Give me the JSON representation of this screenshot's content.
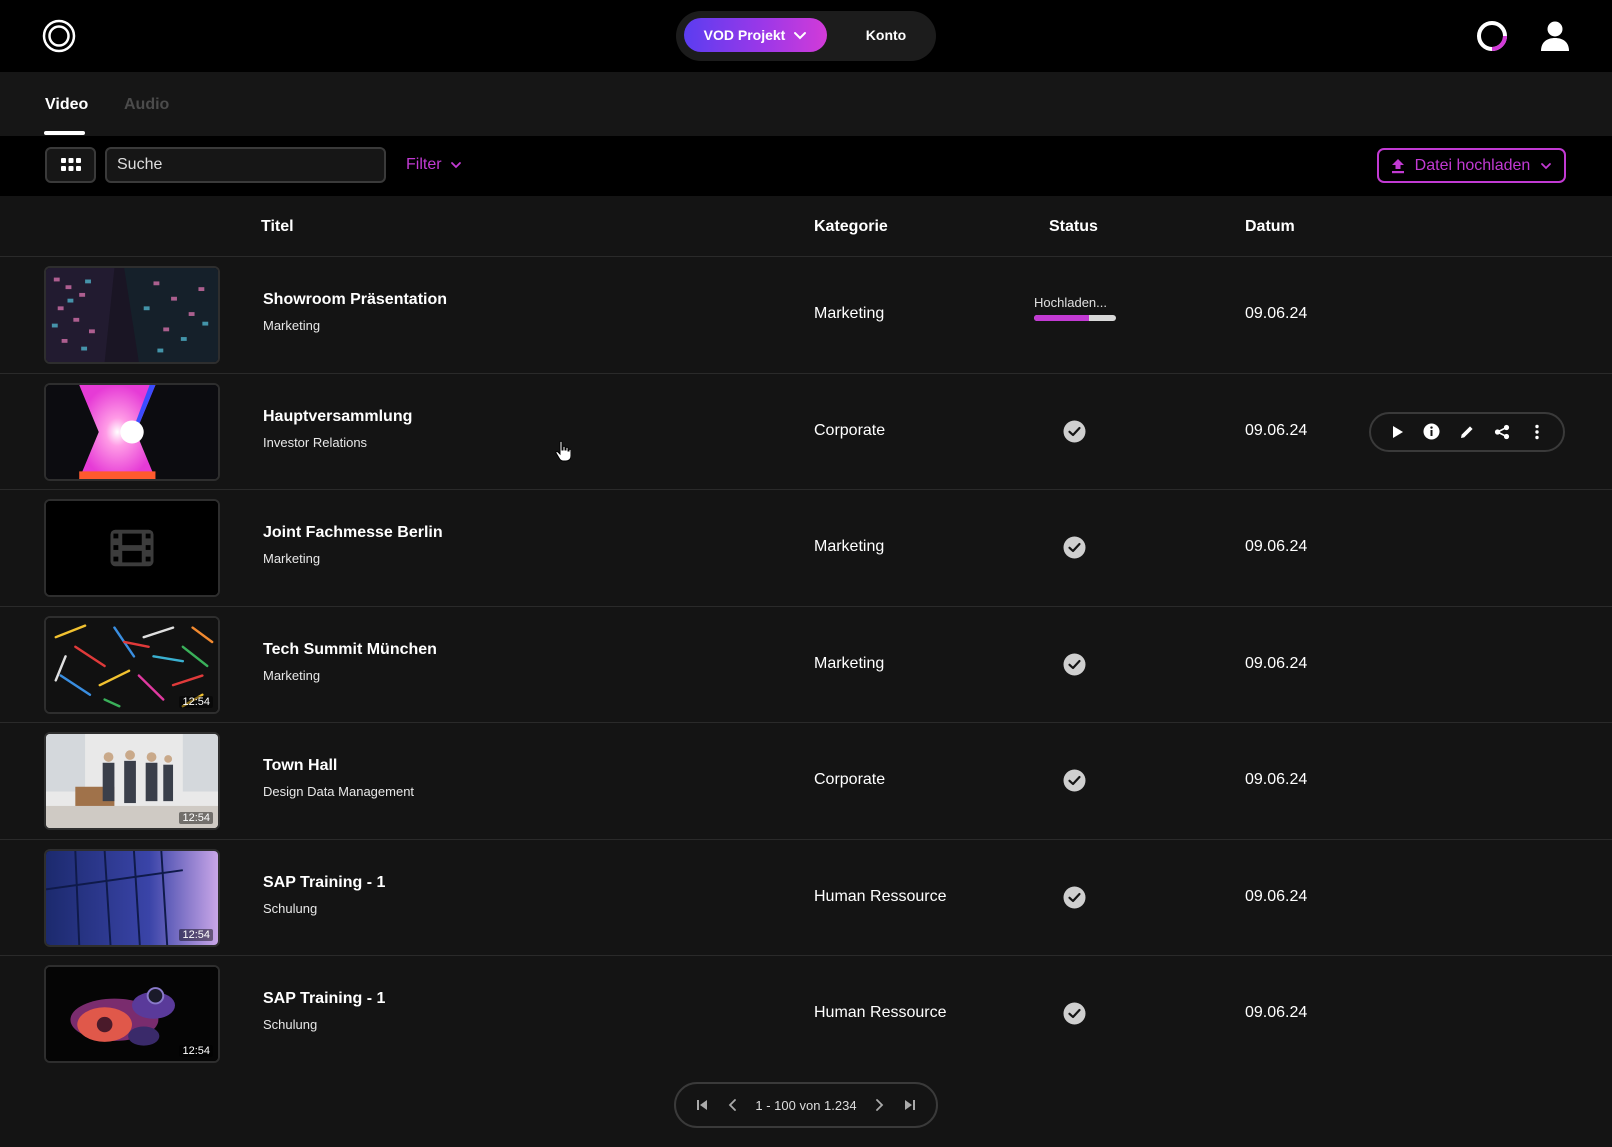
{
  "header": {
    "logo_icon": "ring-logo-icon",
    "project_label": "VOD Projekt",
    "account_label": "Konto",
    "status_icon": "progress-ring-icon",
    "user_icon": "user-icon",
    "accent_gradient": [
      "#5b3df0",
      "#d23bd8"
    ]
  },
  "tabs": [
    {
      "label": "Video",
      "active": true
    },
    {
      "label": "Audio",
      "active": false
    }
  ],
  "toolbar": {
    "view_icon": "grid-icon",
    "search_placeholder": "Suche",
    "filter_label": "Filter",
    "upload_label": "Datei hochladen",
    "accent": "#c23ad3"
  },
  "table": {
    "columns": [
      "Titel",
      "Kategorie",
      "Status",
      "Datum"
    ],
    "rows": [
      {
        "title": "Showroom Präsentation",
        "subtitle": "Marketing",
        "category": "Marketing",
        "status": "Hochladen...",
        "progress": 0.67,
        "date": "09.06.24",
        "duration": ""
      },
      {
        "title": "Hauptversammlung",
        "subtitle": "Investor Relations",
        "category": "Corporate",
        "status": "done",
        "date": "09.06.24",
        "duration": ""
      },
      {
        "title": "Joint Fachmesse Berlin",
        "subtitle": "Marketing",
        "category": "Marketing",
        "status": "done",
        "date": "09.06.24",
        "duration": ""
      },
      {
        "title": "Tech Summit München",
        "subtitle": "Marketing",
        "category": "Marketing",
        "status": "done",
        "date": "09.06.24",
        "duration": "12:54"
      },
      {
        "title": "Town Hall",
        "subtitle": "Design Data Management",
        "category": "Corporate",
        "status": "done",
        "date": "09.06.24",
        "duration": "12:54"
      },
      {
        "title": "SAP Training - 1",
        "subtitle": "Schulung",
        "category": "Human Ressource",
        "status": "done",
        "date": "09.06.24",
        "duration": "12:54"
      },
      {
        "title": "SAP Training - 1",
        "subtitle": "Schulung",
        "category": "Human Ressource",
        "status": "done",
        "date": "09.06.24",
        "duration": "12:54"
      }
    ],
    "row_actions": [
      "play-icon",
      "info-icon",
      "edit-icon",
      "share-icon",
      "more-icon"
    ]
  },
  "pagination": {
    "range_label": "1 - 100 von 1.234"
  }
}
